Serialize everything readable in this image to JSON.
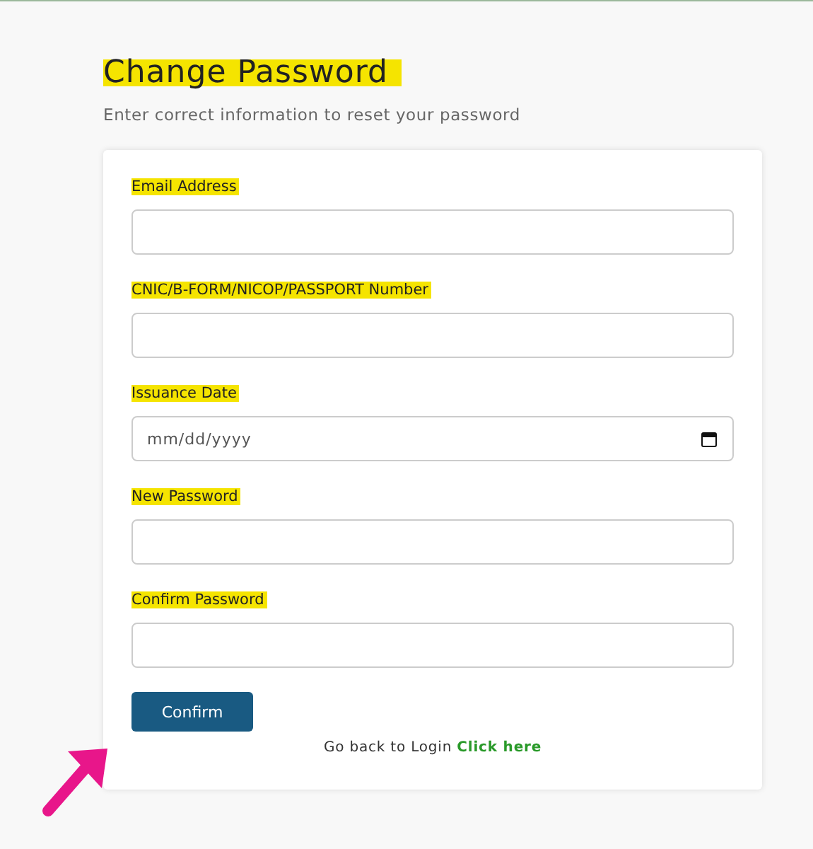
{
  "title": {
    "text": "Change Password",
    "highlighted": true
  },
  "subtitle": "Enter correct information to reset your password",
  "fields": [
    {
      "kind": "text",
      "label": "Email Address",
      "highlighted": true
    },
    {
      "kind": "text",
      "label": "CNIC/B-FORM/NICOP/PASSPORT Number",
      "highlighted": true
    },
    {
      "kind": "date",
      "label": "Issuance Date",
      "highlighted": true,
      "placeholder": "mm/dd/yyyy"
    },
    {
      "kind": "password",
      "label": "New Password",
      "highlighted": true
    },
    {
      "kind": "password",
      "label": "Confirm Password",
      "highlighted": true
    }
  ],
  "confirm_button": "Confirm",
  "back_text": "Go back to Login",
  "back_link": "Click here",
  "annotation_arrow": true
}
